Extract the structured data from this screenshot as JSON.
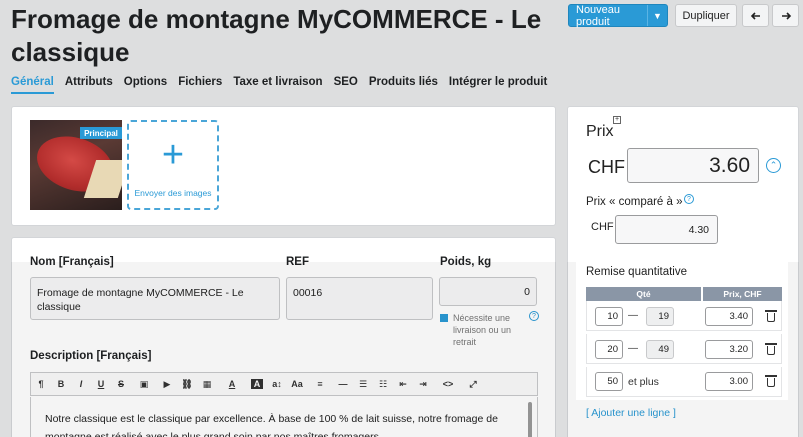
{
  "page": {
    "title": "Fromage de montagne MyCOMMERCE - Le classique"
  },
  "header_buttons": {
    "new_product": "Nouveau produit",
    "duplicate": "Dupliquer",
    "prev_icon": "arrow-left-icon",
    "next_icon": "arrow-right-icon"
  },
  "tabs": [
    {
      "label": "Général",
      "active": true
    },
    {
      "label": "Attributs"
    },
    {
      "label": "Options"
    },
    {
      "label": "Fichiers"
    },
    {
      "label": "Taxe et livraison"
    },
    {
      "label": "SEO"
    },
    {
      "label": "Produits liés"
    },
    {
      "label": "Intégrer le produit"
    }
  ],
  "images": {
    "main_badge": "Principal",
    "upload_label": "Envoyer des images"
  },
  "fields": {
    "name_label": "Nom [Français]",
    "name_value": "Fromage de montagne MyCOMMERCE - Le classique",
    "ref_label": "REF",
    "ref_value": "00016",
    "weight_label": "Poids, kg",
    "weight_value": "0",
    "shipping_checkbox": "Nécessite une livraison ou un retrait",
    "description_label": "Description [Français]",
    "description_text": "Notre classique est le classique par excellence. À base de 100 % de lait suisse, notre fromage de montagne est réalisé avec le plus grand soin par nos maîtres fromagers."
  },
  "toolbar": [
    "¶",
    "B",
    "I",
    "U",
    "S",
    "img",
    "▶",
    "⛓",
    "▦",
    "A",
    "A",
    "a↕",
    "Aa",
    "≡",
    "—",
    "☰",
    "☷",
    "⇤",
    "⇥",
    "<>",
    "⤢"
  ],
  "price": {
    "label": "Prix",
    "currency": "CHF",
    "value": "3.60",
    "compare_label": "Prix « comparé à »",
    "compare_currency": "CHF",
    "compare_value": "4.30"
  },
  "quantity_discount": {
    "title": "Remise quantitative",
    "col_qty": "Qté",
    "col_price": "Prix, CHF",
    "rows": [
      {
        "from": "10",
        "to": "19",
        "price": "3.40"
      },
      {
        "from": "20",
        "to": "49",
        "price": "3.20"
      },
      {
        "from": "50",
        "to_text": "et plus",
        "price": "3.00"
      }
    ],
    "dash": "—",
    "add_line": "[ Ajouter une ligne ]"
  },
  "colors": {
    "accent": "#2a9ad6",
    "table_header": "#8a96a6"
  }
}
